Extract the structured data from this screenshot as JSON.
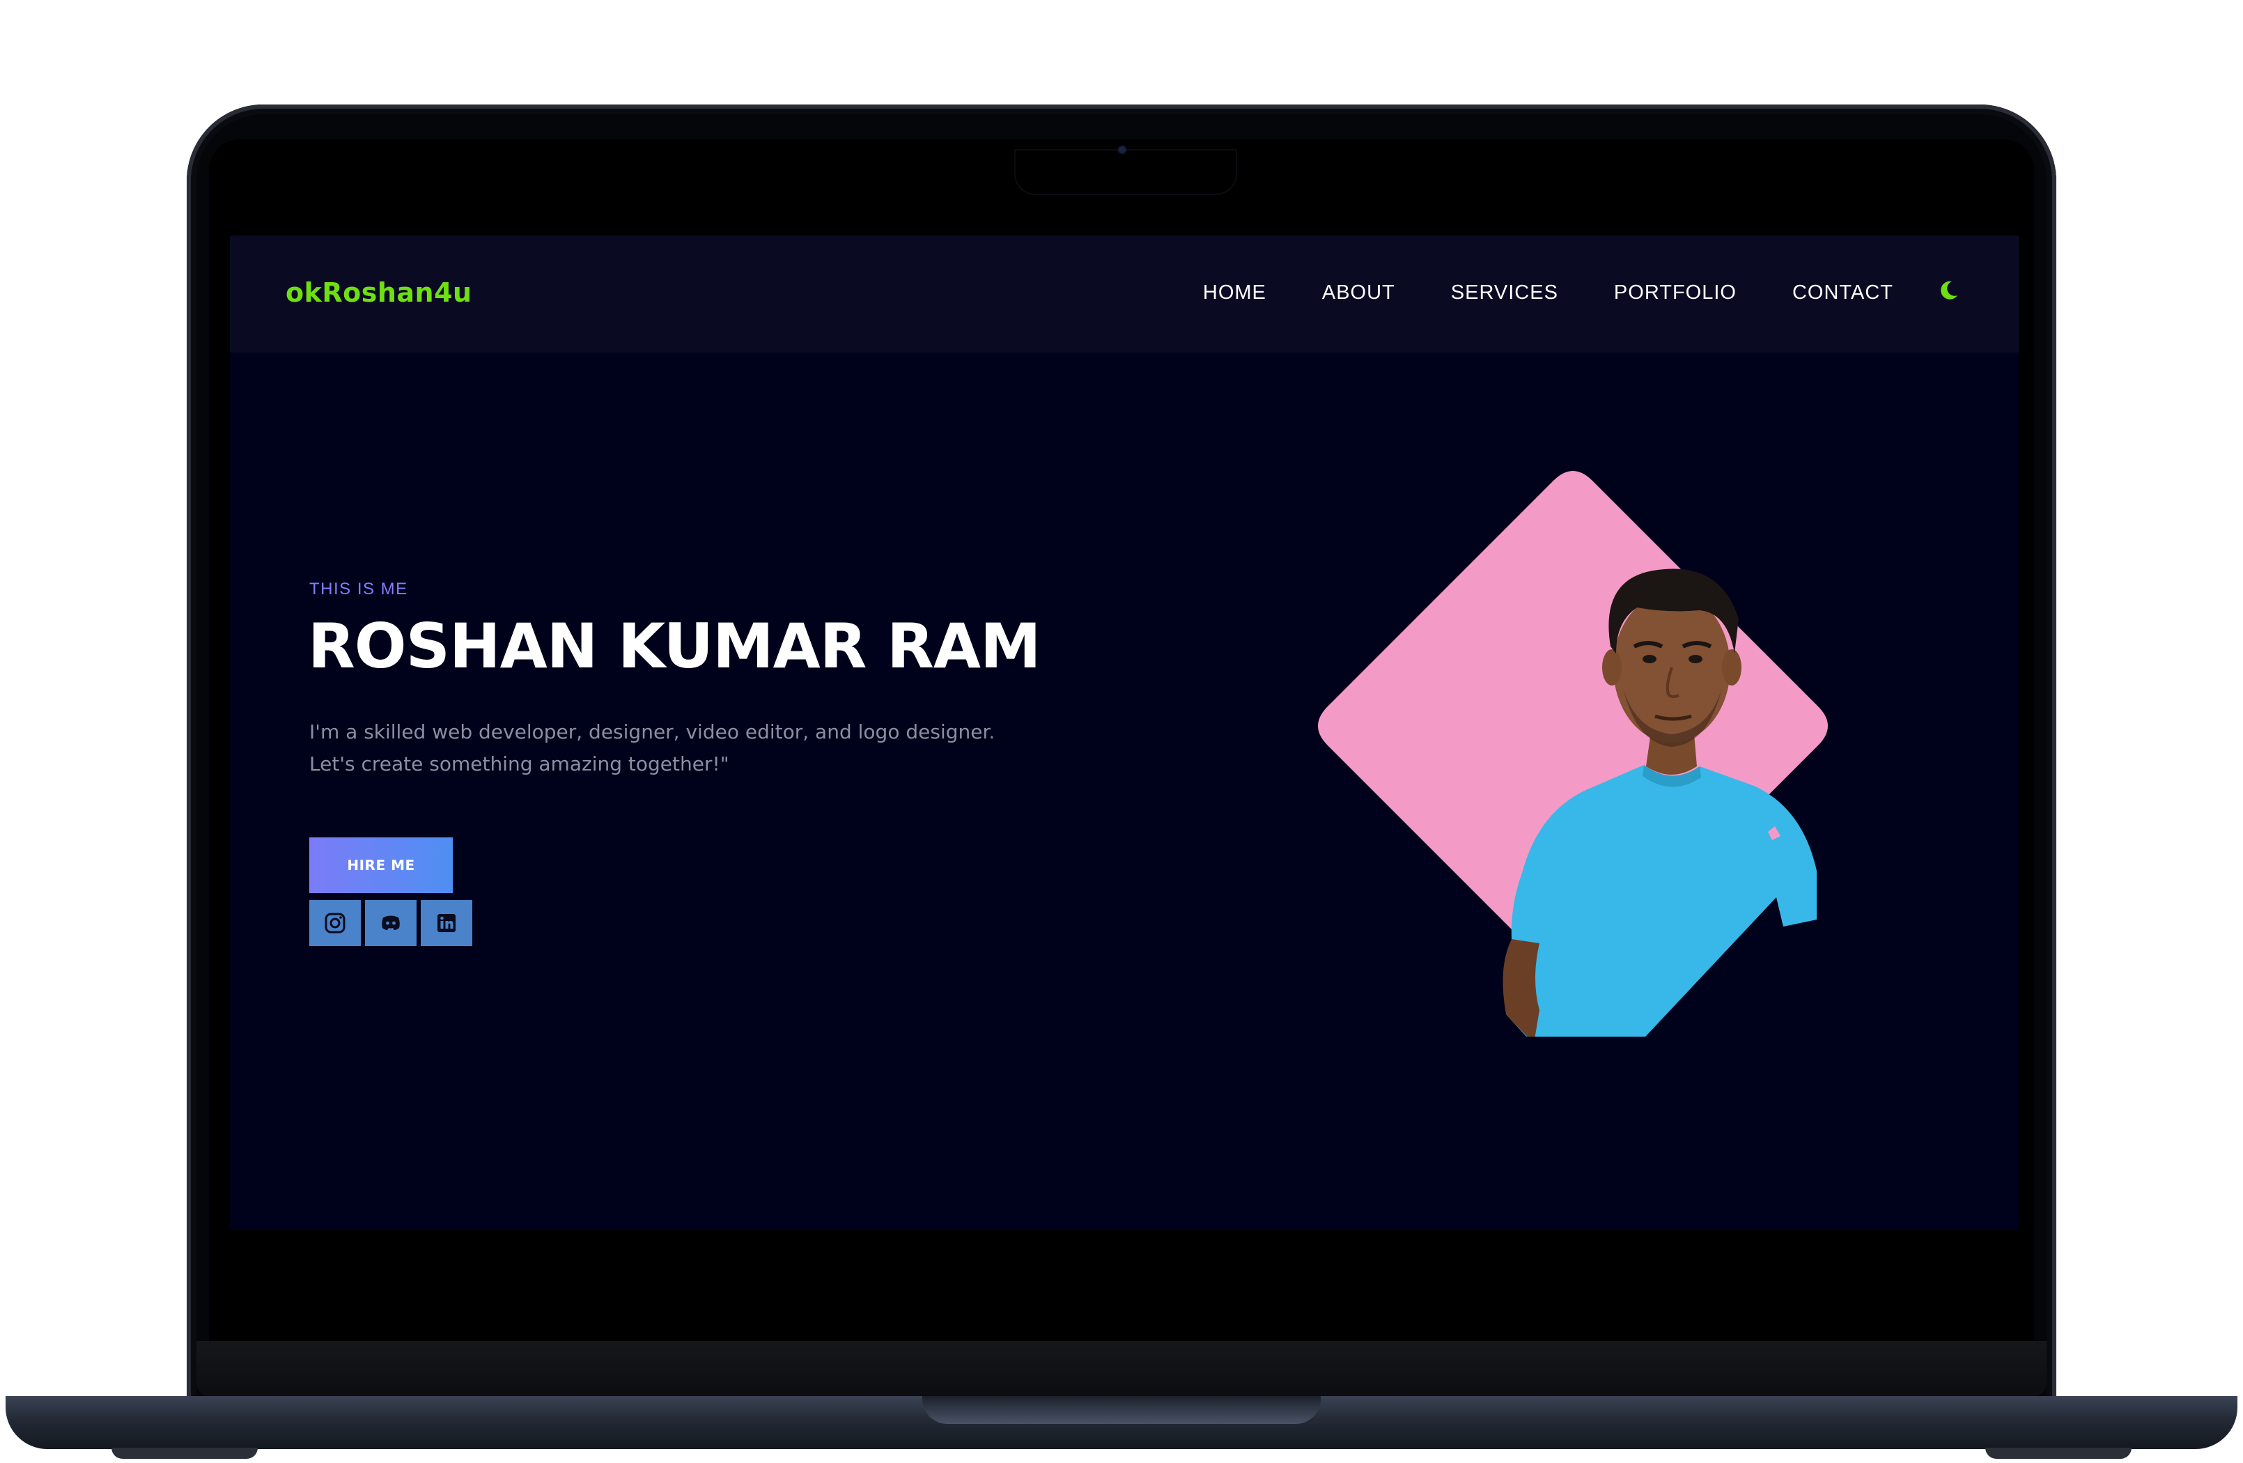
{
  "site": {
    "logo": "okRoshan4u",
    "nav": [
      "HOME",
      "ABOUT",
      "SERVICES",
      "PORTFOLIO",
      "CONTACT"
    ],
    "theme_toggle_icon": "moon-icon"
  },
  "hero": {
    "eyebrow": "THIS IS ME",
    "name": "ROSHAN KUMAR RAM",
    "bio_line1": "I'm a skilled web developer, designer, video editor, and logo designer.",
    "bio_line2": "Let's create something amazing together!\"",
    "cta_label": "HIRE ME",
    "socials": [
      "instagram-icon",
      "discord-icon",
      "linkedin-icon"
    ]
  },
  "colors": {
    "background": "#00011a",
    "nav_background": "#0a0b23",
    "logo": "#6ee012",
    "accent": "#7f7fff",
    "diamond": "#f49ac6",
    "social_button": "#4a83c9"
  }
}
